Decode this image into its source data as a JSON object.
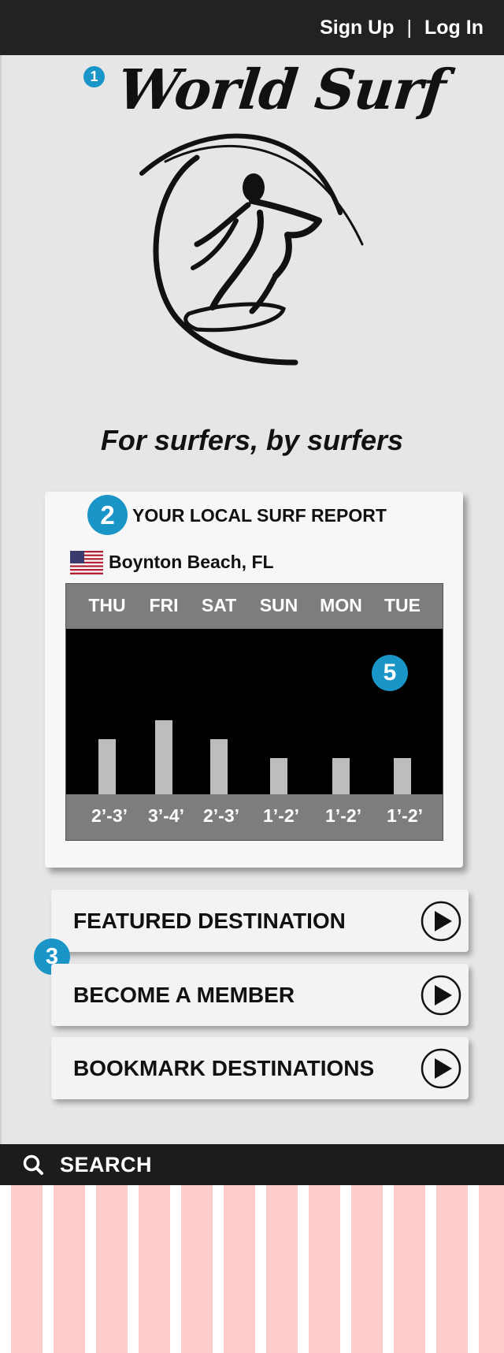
{
  "topbar": {
    "sign_up": "Sign Up",
    "separator": "|",
    "log_in": "Log In"
  },
  "logo": {
    "title": "World Surf",
    "art_icon": "surfer-in-wave-logo"
  },
  "annotations": {
    "badge_1": "1",
    "badge_2": "2",
    "badge_3": "3",
    "badge_5": "5"
  },
  "tagline": "For surfers, by surfers",
  "surf_report": {
    "title": "YOUR LOCAL SURF REPORT",
    "flag_icon": "us-flag-icon",
    "location": "Boynton Beach, FL",
    "days": [
      "THU",
      "FRI",
      "SAT",
      "SUN",
      "MON",
      "TUE"
    ],
    "wave_heights": [
      "2’-3’",
      "3’-4’",
      "2’-3’",
      "1’-2’",
      "1’-2’",
      "1’-2’"
    ],
    "wave_max_ft": [
      3,
      4,
      3,
      2,
      2,
      2
    ],
    "bar_color": "#bdbdbd"
  },
  "menu": [
    {
      "label": "FEATURED DESTINATION",
      "icon": "play-icon"
    },
    {
      "label": "BECOME A MEMBER",
      "icon": "play-icon"
    },
    {
      "label": "BOOKMARK DESTINATIONS",
      "icon": "play-icon"
    }
  ],
  "search": {
    "label": "SEARCH",
    "icon": "search-icon"
  },
  "colors": {
    "accent": "#1a95c8",
    "dark_bar": "#222222",
    "stripe_pink": "#fecccc"
  }
}
